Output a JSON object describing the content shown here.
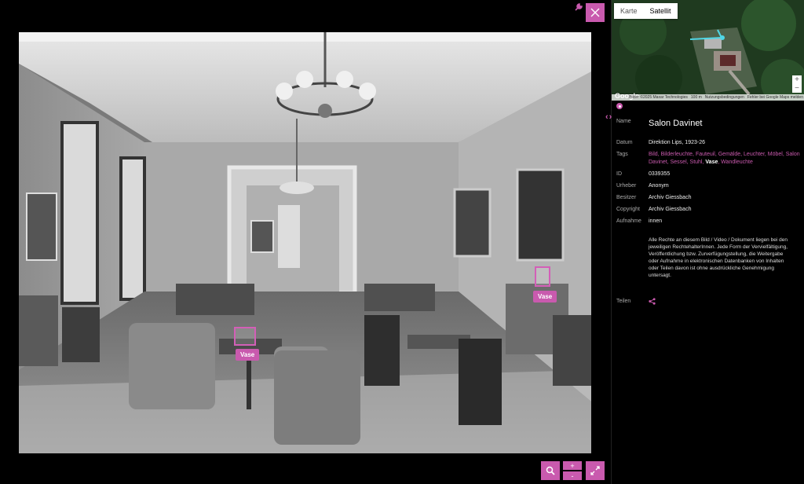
{
  "hotspots": [
    {
      "label": "Vase"
    },
    {
      "label": "Vase"
    }
  ],
  "controls": {
    "close_icon": "close-icon",
    "search_icon": "search-icon",
    "zoom_in": "+",
    "zoom_out": "-",
    "fullscreen_icon": "expand-icon",
    "settings_icon": "wrench-icon"
  },
  "map": {
    "tabs": [
      "Karte",
      "Satellit"
    ],
    "active_tab": "Satellit",
    "zoom_in": "+",
    "zoom_out": "−",
    "logo": "Google",
    "attribution": "Bilder ©2025 Maxar Technologies",
    "terms": "Nutzungsbedingungen",
    "report": "Fehler bei Google Maps melden",
    "scale": "100 m"
  },
  "info": {
    "name_label": "Name",
    "name": "Salon Davinet",
    "datum_label": "Datum",
    "datum": "Direktion Lips, 1923-26",
    "tags_label": "Tags",
    "tags": [
      {
        "text": "Bild",
        "style": "pink"
      },
      {
        "text": "Bilderleuchte",
        "style": "pink"
      },
      {
        "text": "Fauteuil",
        "style": "pink"
      },
      {
        "text": "Gemälde",
        "style": "pink"
      },
      {
        "text": "Leuchter",
        "style": "pink"
      },
      {
        "text": "Möbel",
        "style": "pink"
      },
      {
        "text": "Salon Davinet",
        "style": "pink"
      },
      {
        "text": "Sessel",
        "style": "pink"
      },
      {
        "text": "Stuhl",
        "style": "pink"
      },
      {
        "text": "Vase",
        "style": "white"
      },
      {
        "text": "Wandleuchte",
        "style": "pink"
      }
    ],
    "id_label": "ID",
    "id": "0339355",
    "urheber_label": "Urheber",
    "urheber": "Anonym",
    "besitzer_label": "Besitzer",
    "besitzer": "Archiv Giessbach",
    "copyright_label": "Copyright",
    "copyright": "Archiv Giessbach",
    "aufnahme_label": "Aufnahme",
    "aufnahme": "innen",
    "rights": "Alle Rechte an diesem Bild / Video / Dokument liegen bei den jeweiligen RechtehalterInnen. Jede Form der Vervielfältigung, Veröffentlichung bzw. Zurverfügungstellung, die Weitergabe oder Aufnahme in elektronischen Datenbanken von Inhalten oder Teilen davon ist ohne ausdrückliche Genehmigung untersagt.",
    "teilen_label": "Teilen"
  },
  "colors": {
    "accent": "#c95aae",
    "background": "#000000"
  }
}
